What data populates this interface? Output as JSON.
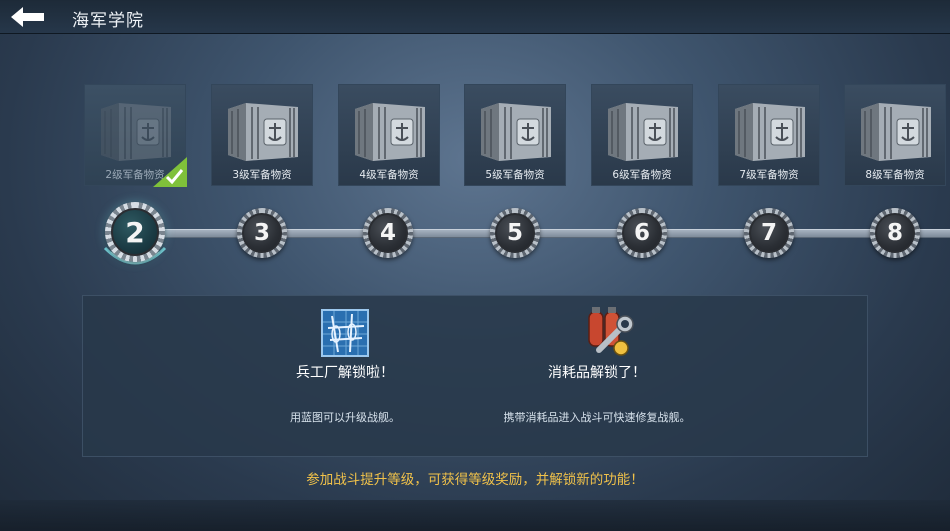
{
  "header": {
    "title": "海军学院",
    "back_icon": "back-arrow-icon"
  },
  "crates": [
    {
      "label": "2级军备物资",
      "claimed": true
    },
    {
      "label": "3级军备物资",
      "claimed": false
    },
    {
      "label": "4级军备物资",
      "claimed": false
    },
    {
      "label": "5级军备物资",
      "claimed": false
    },
    {
      "label": "6级军备物资",
      "claimed": false
    },
    {
      "label": "7级军备物资",
      "claimed": false
    },
    {
      "label": "8级军备物资",
      "claimed": false
    }
  ],
  "levels": [
    "2",
    "3",
    "4",
    "5",
    "6",
    "7",
    "8"
  ],
  "current_level": "2",
  "unlocks": [
    {
      "title": "兵工厂解锁啦！",
      "desc": "用蓝图可以升级战舰。",
      "icon": "blueprint-icon"
    },
    {
      "title": "消耗品解锁了！",
      "desc": "携带消耗品进入战斗可快速修复战舰。",
      "icon": "consumable-repair-icon"
    }
  ],
  "footer_text": "参加战斗提升等级，可获得等级奖励，并解锁新的功能！",
  "colors": {
    "accent_gold": "#f1c24a",
    "check_green": "#7fc13a",
    "current_glow": "#7ad8e0"
  }
}
